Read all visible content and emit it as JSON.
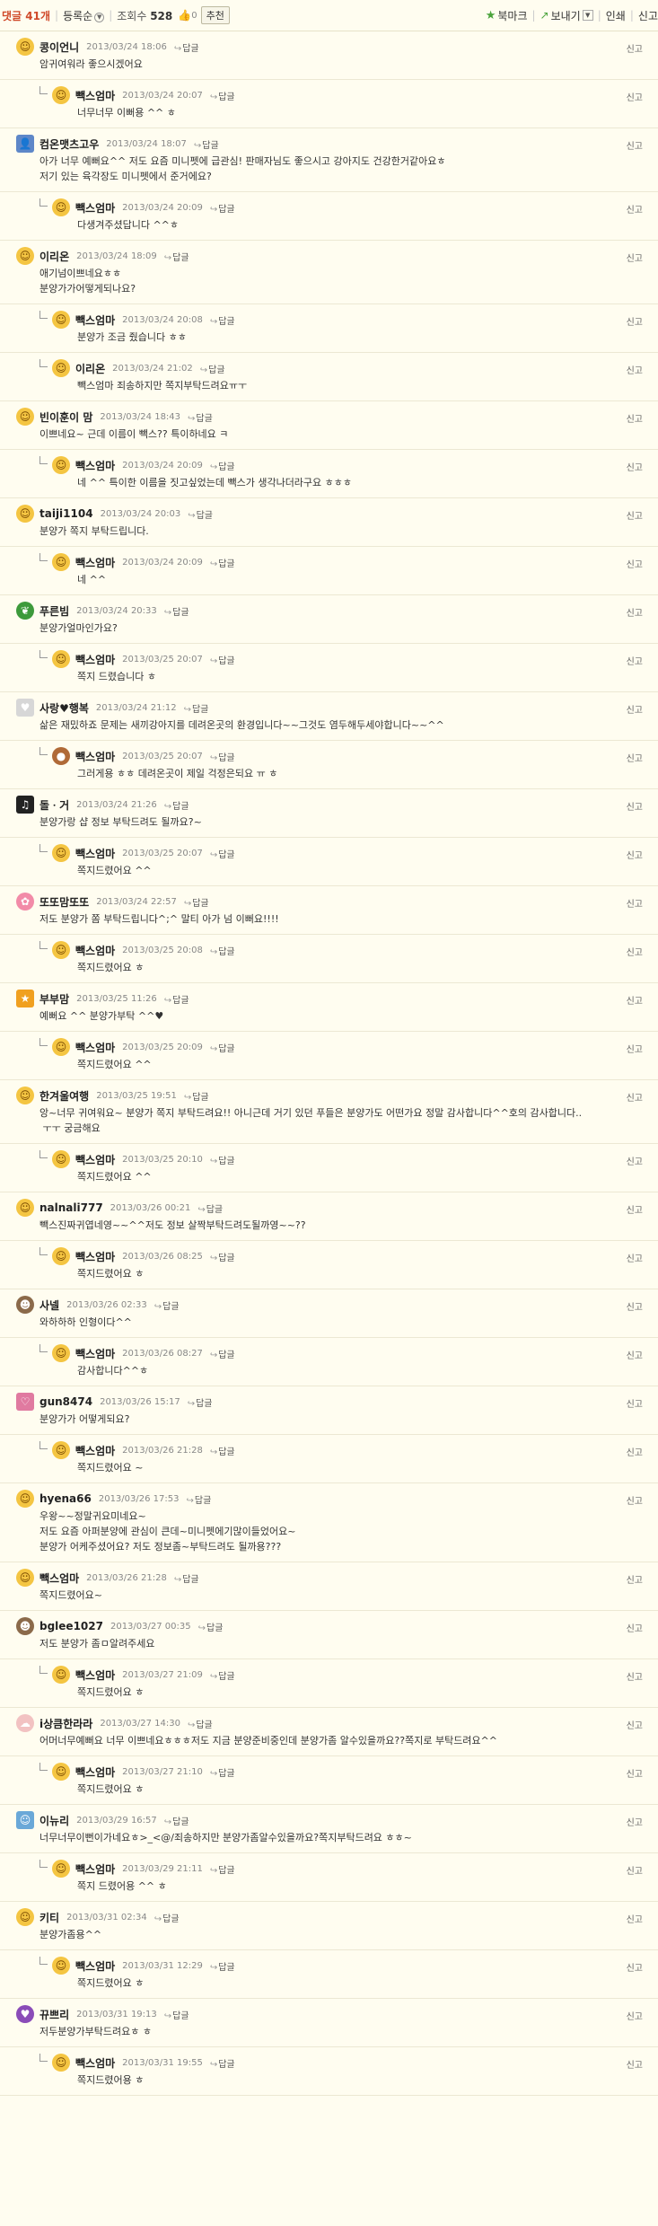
{
  "toolbar": {
    "comment_label": "댓글",
    "comment_count": "41개",
    "sort_label": "등록순",
    "views_label": "조회수",
    "views_count": "528",
    "likes": "0",
    "recommend_label": "추천",
    "bookmark_label": "북마크",
    "share_label": "보내기",
    "print_label": "인쇄",
    "report_label": "신고"
  },
  "report_label": "신고",
  "reply_label": "답글",
  "comments": [
    {
      "level": 1,
      "avatar": "av-smile",
      "nick": "콩이언니",
      "date": "2013/03/24 18:06",
      "text": "암귀여워라 좋으시겠어요"
    },
    {
      "level": 2,
      "avatar": "av-smile",
      "nick": "빽스엄마",
      "date": "2013/03/24 20:07",
      "text": "너무너무 이뻐용 ^^ ㅎ"
    },
    {
      "level": 1,
      "avatar": "av-user",
      "nick": "컴온맷츠고우",
      "date": "2013/03/24 18:07",
      "text": "아가 너무 예뻐요^^ 저도 요즘 미니펫에 급관심! 판매자님도 좋으시고 강아지도 건강한거같아요ㅎ\n저기 있는 육각장도 미니펫에서 준거에요?"
    },
    {
      "level": 2,
      "avatar": "av-smile",
      "nick": "빽스엄마",
      "date": "2013/03/24 20:09",
      "text": "다생겨주셨답니다 ^^ㅎ"
    },
    {
      "level": 1,
      "avatar": "av-smile",
      "nick": "이리온",
      "date": "2013/03/24 18:09",
      "text": "애기넘이쁘네요ㅎㅎ\n분양가가어떻게되나요?"
    },
    {
      "level": 2,
      "avatar": "av-smile",
      "nick": "빽스엄마",
      "date": "2013/03/24 20:08",
      "text": "분양가 조금 줬습니다 ㅎㅎ"
    },
    {
      "level": 2,
      "avatar": "av-smile",
      "nick": "이리온",
      "date": "2013/03/24 21:02",
      "text": "빽스엄마 죄송하지만 쪽지부탁드려요ㅠㅜ"
    },
    {
      "level": 1,
      "avatar": "av-smile",
      "nick": "빈이훈이 맘",
      "date": "2013/03/24 18:43",
      "text": "이쁘네요~ 근데 이름이 빽스?? 특이하네요 ㅋ"
    },
    {
      "level": 2,
      "avatar": "av-smile",
      "nick": "빽스엄마",
      "date": "2013/03/24 20:09",
      "text": "네 ^^ 특이한 이름을 짓고싶었는데 빽스가 생각나더라구요 ㅎㅎㅎ"
    },
    {
      "level": 1,
      "avatar": "av-smile",
      "nick": "taiji1104",
      "date": "2013/03/24 20:03",
      "text": "분양가 쪽지 부탁드립니다."
    },
    {
      "level": 2,
      "avatar": "av-smile",
      "nick": "빽스엄마",
      "date": "2013/03/24 20:09",
      "text": "네 ^^"
    },
    {
      "level": 1,
      "avatar": "av-leaf",
      "nick": "푸른빔",
      "date": "2013/03/24 20:33",
      "text": "분양가얼마인가요?"
    },
    {
      "level": 2,
      "avatar": "av-smile",
      "nick": "빽스엄마",
      "date": "2013/03/25 20:07",
      "text": "쪽지 드렸습니다 ㅎ"
    },
    {
      "level": 1,
      "avatar": "av-heart",
      "nick": "사랑♥행복",
      "date": "2013/03/24 21:12",
      "text": "삶은 재밌하죠 문제는 새끼강아지를 데려온곳의 환경입니다~~그것도 염두해두세야합니다~~^^"
    },
    {
      "level": 2,
      "avatar": "av-bear",
      "nick": "빽스엄마",
      "date": "2013/03/25 20:07",
      "text": "그러게용 ㅎㅎ 데려온곳이 제일 걱정은되요 ㅠ ㅎ"
    },
    {
      "level": 1,
      "avatar": "av-piano",
      "nick": "돌ㆍ거",
      "date": "2013/03/24 21:26",
      "text": "분양가랑 샵 정보 부탁드려도 될까요?~"
    },
    {
      "level": 2,
      "avatar": "av-smile",
      "nick": "빽스엄마",
      "date": "2013/03/25 20:07",
      "text": "쪽지드렸어요 ^^"
    },
    {
      "level": 1,
      "avatar": "av-flower",
      "nick": "또또맘또또",
      "date": "2013/03/24 22:57",
      "text": "저도 분양가 쫌 부탁드립니다^;^ 말티 아가 넘 이뻐요!!!!"
    },
    {
      "level": 2,
      "avatar": "av-smile",
      "nick": "빽스엄마",
      "date": "2013/03/25 20:08",
      "text": "쪽지드렸어요 ㅎ"
    },
    {
      "level": 1,
      "avatar": "av-star",
      "nick": "부부맘",
      "date": "2013/03/25 11:26",
      "text": "예뻐요 ^^ 분양가부탁 ^^♥"
    },
    {
      "level": 2,
      "avatar": "av-smile",
      "nick": "빽스엄마",
      "date": "2013/03/25 20:09",
      "text": "쪽지드렸어요 ^^"
    },
    {
      "level": 1,
      "avatar": "av-smile",
      "nick": "한겨울여행",
      "date": "2013/03/25 19:51",
      "text": "앙~너무 귀여워요~ 분양가 쪽지 부탁드려요!! 아니근데 거기 있던 푸들은 분양가도 어떤가요 정말 감사합니다^^호의 감사합니다..\n ㅜㅜ 궁금해요"
    },
    {
      "level": 2,
      "avatar": "av-smile",
      "nick": "빽스엄마",
      "date": "2013/03/25 20:10",
      "text": "쪽지드렸어요 ^^"
    },
    {
      "level": 1,
      "avatar": "av-smile",
      "nick": "nalnali777",
      "date": "2013/03/26 00:21",
      "text": "빽스진짜귀엽네영~~^^저도 정보 살짝부탁드려도될까영~~??"
    },
    {
      "level": 2,
      "avatar": "av-smile",
      "nick": "빽스엄마",
      "date": "2013/03/26 08:25",
      "text": "쪽지드렸어요 ㅎ"
    },
    {
      "level": 1,
      "avatar": "av-face",
      "nick": "사넬",
      "date": "2013/03/26 02:33",
      "text": "와하하하 인형이다^^"
    },
    {
      "level": 2,
      "avatar": "av-smile",
      "nick": "빽스엄마",
      "date": "2013/03/26 08:27",
      "text": "감사합니다^^ㅎ"
    },
    {
      "level": 1,
      "avatar": "av-pink",
      "nick": "gun8474",
      "date": "2013/03/26 15:17",
      "text": "분양가가 어떻게되요?"
    },
    {
      "level": 2,
      "avatar": "av-smile",
      "nick": "빽스엄마",
      "date": "2013/03/26 21:28",
      "text": "쪽지드렸어요 ~"
    },
    {
      "level": 1,
      "avatar": "av-smile",
      "nick": "hyena66",
      "date": "2013/03/26 17:53",
      "text": "우왕~~정말귀요미네요~\n저도 요즘 아퍼분양에 관심이 큰데~미니펫에기많이들었어요~\n분양가 어케주셨어요? 저도 정보좀~부탁드려도 될까용???"
    },
    {
      "level": 1,
      "avatar": "av-smile",
      "nick": "빽스엄마",
      "date": "2013/03/26 21:28",
      "text": "쪽지드렸어요~"
    },
    {
      "level": 1,
      "avatar": "av-face",
      "nick": "bglee1027",
      "date": "2013/03/27 00:35",
      "text": "저도 분양가 좀ㅁ알려주세요"
    },
    {
      "level": 2,
      "avatar": "av-smile",
      "nick": "빽스엄마",
      "date": "2013/03/27 21:09",
      "text": "쪽지드렸어요 ㅎ"
    },
    {
      "level": 1,
      "avatar": "av-cloud",
      "nick": "i상큼한라라",
      "date": "2013/03/27 14:30",
      "text": "어머너무예뻐요 너무 이쁘네요ㅎㅎㅎ저도 지금 분양준비중인데 분양가좀 알수있을까요??쪽지로 부탁드려요^^"
    },
    {
      "level": 2,
      "avatar": "av-smile",
      "nick": "빽스엄마",
      "date": "2013/03/27 21:10",
      "text": "쪽지드렸어요 ㅎ"
    },
    {
      "level": 1,
      "avatar": "av-mascot",
      "nick": "이뉴리",
      "date": "2013/03/29 16:57",
      "text": "너무너무이뻔이가네요ㅎ>_<@/죄송하지만 분양가좀알수있을까요?쪽지부탁드려요 ㅎㅎ~"
    },
    {
      "level": 2,
      "avatar": "av-smile",
      "nick": "빽스엄마",
      "date": "2013/03/29 21:11",
      "text": "쪽지 드렸어용 ^^ ㅎ"
    },
    {
      "level": 1,
      "avatar": "av-smile",
      "nick": "키티",
      "date": "2013/03/31 02:34",
      "text": "분양가좀용^^"
    },
    {
      "level": 2,
      "avatar": "av-smile",
      "nick": "빽스엄마",
      "date": "2013/03/31 12:29",
      "text": "쪽지드렸어요 ㅎ"
    },
    {
      "level": 1,
      "avatar": "av-purple",
      "nick": "뀨쁘리",
      "date": "2013/03/31 19:13",
      "text": "저두분양가부탁드려요ㅎ ㅎ"
    },
    {
      "level": 2,
      "avatar": "av-smile",
      "nick": "빽스엄마",
      "date": "2013/03/31 19:55",
      "text": "쪽지드렸어용 ㅎ"
    }
  ]
}
